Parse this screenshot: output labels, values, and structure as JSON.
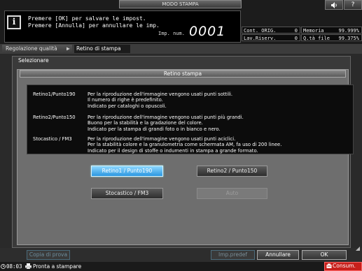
{
  "header": {
    "mode_title": "MODO STAMPA",
    "speaker_icon": "speaker-icon",
    "help_icon": "help-icon",
    "help_label": "?"
  },
  "message": {
    "icon": "info-icon",
    "icon_glyph": "i",
    "line1": "Premere [OK] per salvare le impost.",
    "line2": "Premere [Annulla] per annullare le imp.",
    "imp_label": "Imp. num.",
    "imp_value": "0001"
  },
  "counters": {
    "cont_orig_label": "Cont. ORIG.",
    "cont_orig_value": "0",
    "memoria_label": "Memoria",
    "memoria_value": "99.999%",
    "lav_riserv_label": "Lav.Riserv.",
    "lav_riserv_value": "0",
    "qta_file_label": "Q.tà file",
    "qta_file_value": "99.375%"
  },
  "breadcrumb": {
    "item1": "Regolazione qualità",
    "arrow": "▶",
    "item2": "Retino di stampa"
  },
  "main": {
    "section_label": "Selezionare",
    "panel_title": "Retino stampa",
    "descriptions": [
      {
        "name": "Retino1/Punto190",
        "lines": [
          "Per la riproduzione dell'immagine vengono usati punti sottili.",
          "Il numero di righe è predefinito.",
          "Indicato per cataloghi o opuscoli."
        ]
      },
      {
        "name": "Retino2/Punto150",
        "lines": [
          "Per la riproduzione dell'immagine vengono usati punti più grandi.",
          "Buono per la stabilità e la gradazione del colore.",
          "Indicato per la stampa di grandi foto o in bianco e nero."
        ]
      },
      {
        "name": "Stocastico / FM3",
        "lines": [
          "Per la riproduzione dell'immagine vengono usati punti aciclici.",
          "Per la stabilità colore e la granulometria come schermata AM, fa uso di 200 linee.",
          "Indicato per il design di stoffe o indumenti in stampa a grande formato."
        ]
      }
    ],
    "options": {
      "retino1": "Retino1 / Punto190",
      "retino2": "Retino2 / Punto150",
      "stocastico": "Stocastico / FM3",
      "auto": "Auto",
      "selected": "Retino1 / Punto190"
    }
  },
  "footer": {
    "copia_di_prova": "Copia di prova",
    "imp_predef": "Imp.predef",
    "annullare": "Annullare",
    "ok": "OK"
  },
  "status": {
    "time": "08:03",
    "printer_icon": "printer-icon",
    "text": "Pronta a stampare",
    "consum_label": "Consum.",
    "consum_icon": "toner-icon"
  },
  "colors": {
    "selected_button": "#2b97e0",
    "consum_alert": "#c8201b",
    "background": "#2a2a2a"
  }
}
